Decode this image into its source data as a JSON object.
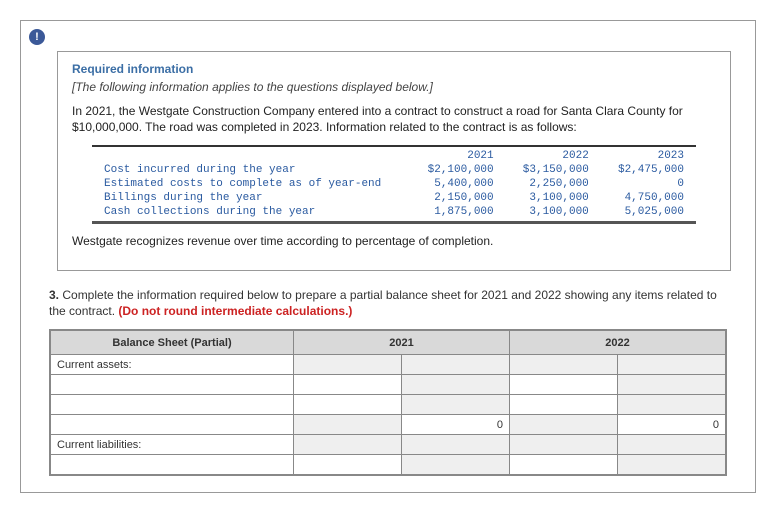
{
  "header": {
    "required": "Required information",
    "note": "[The following information applies to the questions displayed below.]",
    "intro": "In 2021, the Westgate Construction Company entered into a contract to construct a road for Santa Clara County for $10,000,000. The road was completed in 2023. Information related to the contract is as follows:"
  },
  "datacols": {
    "y1": "2021",
    "y2": "2022",
    "y3": "2023"
  },
  "rows": {
    "r1": {
      "label": "Cost incurred during the year",
      "y1": "$2,100,000",
      "y2": "$3,150,000",
      "y3": "$2,475,000"
    },
    "r2": {
      "label": "Estimated costs to complete as of year-end",
      "y1": "5,400,000",
      "y2": "2,250,000",
      "y3": "0"
    },
    "r3": {
      "label": "Billings during the year",
      "y1": "2,150,000",
      "y2": "3,100,000",
      "y3": "4,750,000"
    },
    "r4": {
      "label": "Cash collections during the year",
      "y1": "1,875,000",
      "y2": "3,100,000",
      "y3": "5,025,000"
    }
  },
  "footer_line": "Westgate recognizes revenue over time according to percentage of completion.",
  "question": {
    "num": "3.",
    "text": " Complete the information required below to prepare a partial balance sheet for 2021 and 2022 showing any items related to the contract. ",
    "red": "(Do not round intermediate calculations.)"
  },
  "sheet": {
    "title": "Balance Sheet (Partial)",
    "c2021": "2021",
    "c2022": "2022",
    "current_assets": "Current assets:",
    "current_liab": "Current liabilities:",
    "zero": "0"
  }
}
